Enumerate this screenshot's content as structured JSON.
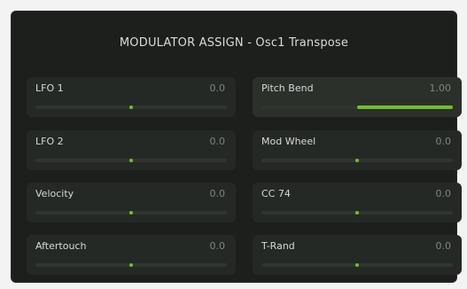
{
  "title": "MODULATOR ASSIGN - Osc1 Transpose",
  "accent_color": "#6fbf2e",
  "left_column": [
    {
      "label": "LFO 1",
      "value": "0.0",
      "amount": 0.0
    },
    {
      "label": "LFO 2",
      "value": "0.0",
      "amount": 0.0
    },
    {
      "label": "Velocity",
      "value": "0.0",
      "amount": 0.0
    },
    {
      "label": "Aftertouch",
      "value": "0.0",
      "amount": 0.0
    }
  ],
  "right_column": [
    {
      "label": "Pitch Bend",
      "value": "1.00",
      "amount": 1.0
    },
    {
      "label": "Mod Wheel",
      "value": "0.0",
      "amount": 0.0
    },
    {
      "label": "CC 74",
      "value": "0.0",
      "amount": 0.0
    },
    {
      "label": "T-Rand",
      "value": "0.0",
      "amount": 0.0
    }
  ]
}
